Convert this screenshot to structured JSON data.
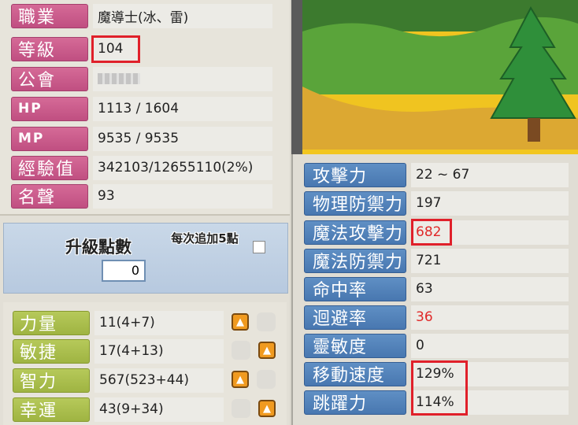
{
  "left_info": {
    "job_label": "職業",
    "job_value": "魔導士(冰、雷)",
    "level_label": "等級",
    "level_value": "104",
    "guild_label": "公會",
    "guild_value": "",
    "hp_label": "HP",
    "hp_value": "1113 / 1604",
    "mp_label": "MP",
    "mp_value": "9535 / 9535",
    "exp_label": "經驗值",
    "exp_value": "342103/12655110(2%)",
    "fame_label": "名聲",
    "fame_value": "93"
  },
  "level_up": {
    "title": "升級點數",
    "points": "0",
    "add5_label": "每次追加5點"
  },
  "stats": [
    {
      "label": "力量",
      "value": "11(4+7)"
    },
    {
      "label": "敏捷",
      "value": "17(4+13)"
    },
    {
      "label": "智力",
      "value": "567(523+44)"
    },
    {
      "label": "幸運",
      "value": "43(9+34)"
    }
  ],
  "right_stats": [
    {
      "label": "攻擊力",
      "value": "22 ~ 67"
    },
    {
      "label": "物理防禦力",
      "value": "197"
    },
    {
      "label": "魔法攻擊力",
      "value": "682"
    },
    {
      "label": "魔法防禦力",
      "value": "721"
    },
    {
      "label": "命中率",
      "value": "63"
    },
    {
      "label": "迴避率",
      "value": "36"
    },
    {
      "label": "靈敏度",
      "value": "0"
    },
    {
      "label": "移動速度",
      "value": "129%"
    },
    {
      "label": "跳躍力",
      "value": "114%"
    }
  ],
  "colors": {
    "highlight": "#e0202a",
    "red_value": "#e02828"
  },
  "icons": {
    "up": "arrow-up-icon"
  }
}
